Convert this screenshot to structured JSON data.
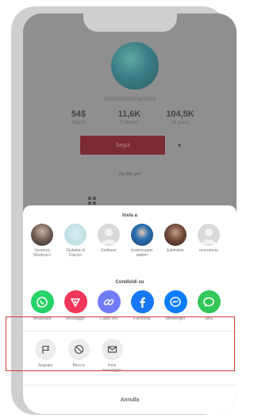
{
  "profile": {
    "username": "sosicannymarodel",
    "stats": [
      {
        "value": "54$",
        "label": "Segniti"
      },
      {
        "value": "11,6K",
        "label": "Follower"
      },
      {
        "value": "104,5K",
        "label": "Mi piace"
      }
    ],
    "follow_label": "Segui",
    "more_label": "▾",
    "bio": "No bio yet"
  },
  "share_sheet": {
    "title": "Invia a",
    "contacts": [
      {
        "name": "Veronica Montrucci"
      },
      {
        "name": "Giulietta di Ciaccio"
      },
      {
        "name": "Emiliano"
      },
      {
        "name": "bookmopper walleri"
      },
      {
        "name": "Edelmilan"
      },
      {
        "name": "moredonia"
      }
    ],
    "apps_title": "Condividi su",
    "apps": [
      {
        "label": "WhatsApp",
        "color": "#25D366",
        "icon": "whatsapp-icon"
      },
      {
        "label": "Messaggio",
        "color": "#F0365A",
        "icon": "message-icon"
      },
      {
        "label": "Copia link",
        "color": "#6F7BF7",
        "icon": "link-icon"
      },
      {
        "label": "Facebook",
        "color": "#1877F2",
        "icon": "facebook-icon"
      },
      {
        "label": "Messenger",
        "color": "#0A7CFF",
        "icon": "messenger-icon"
      },
      {
        "label": "SMS",
        "color": "#34C759",
        "icon": "sms-icon"
      }
    ],
    "actions": [
      {
        "label": "Segnala",
        "icon": "flag-icon"
      },
      {
        "label": "Blocca",
        "icon": "block-icon"
      },
      {
        "label": "Invia messaggio",
        "icon": "mail-icon"
      }
    ],
    "cancel_label": "Annulla"
  },
  "colors": {
    "highlight": "#D0383F",
    "follow_button": "#7C2B34"
  }
}
